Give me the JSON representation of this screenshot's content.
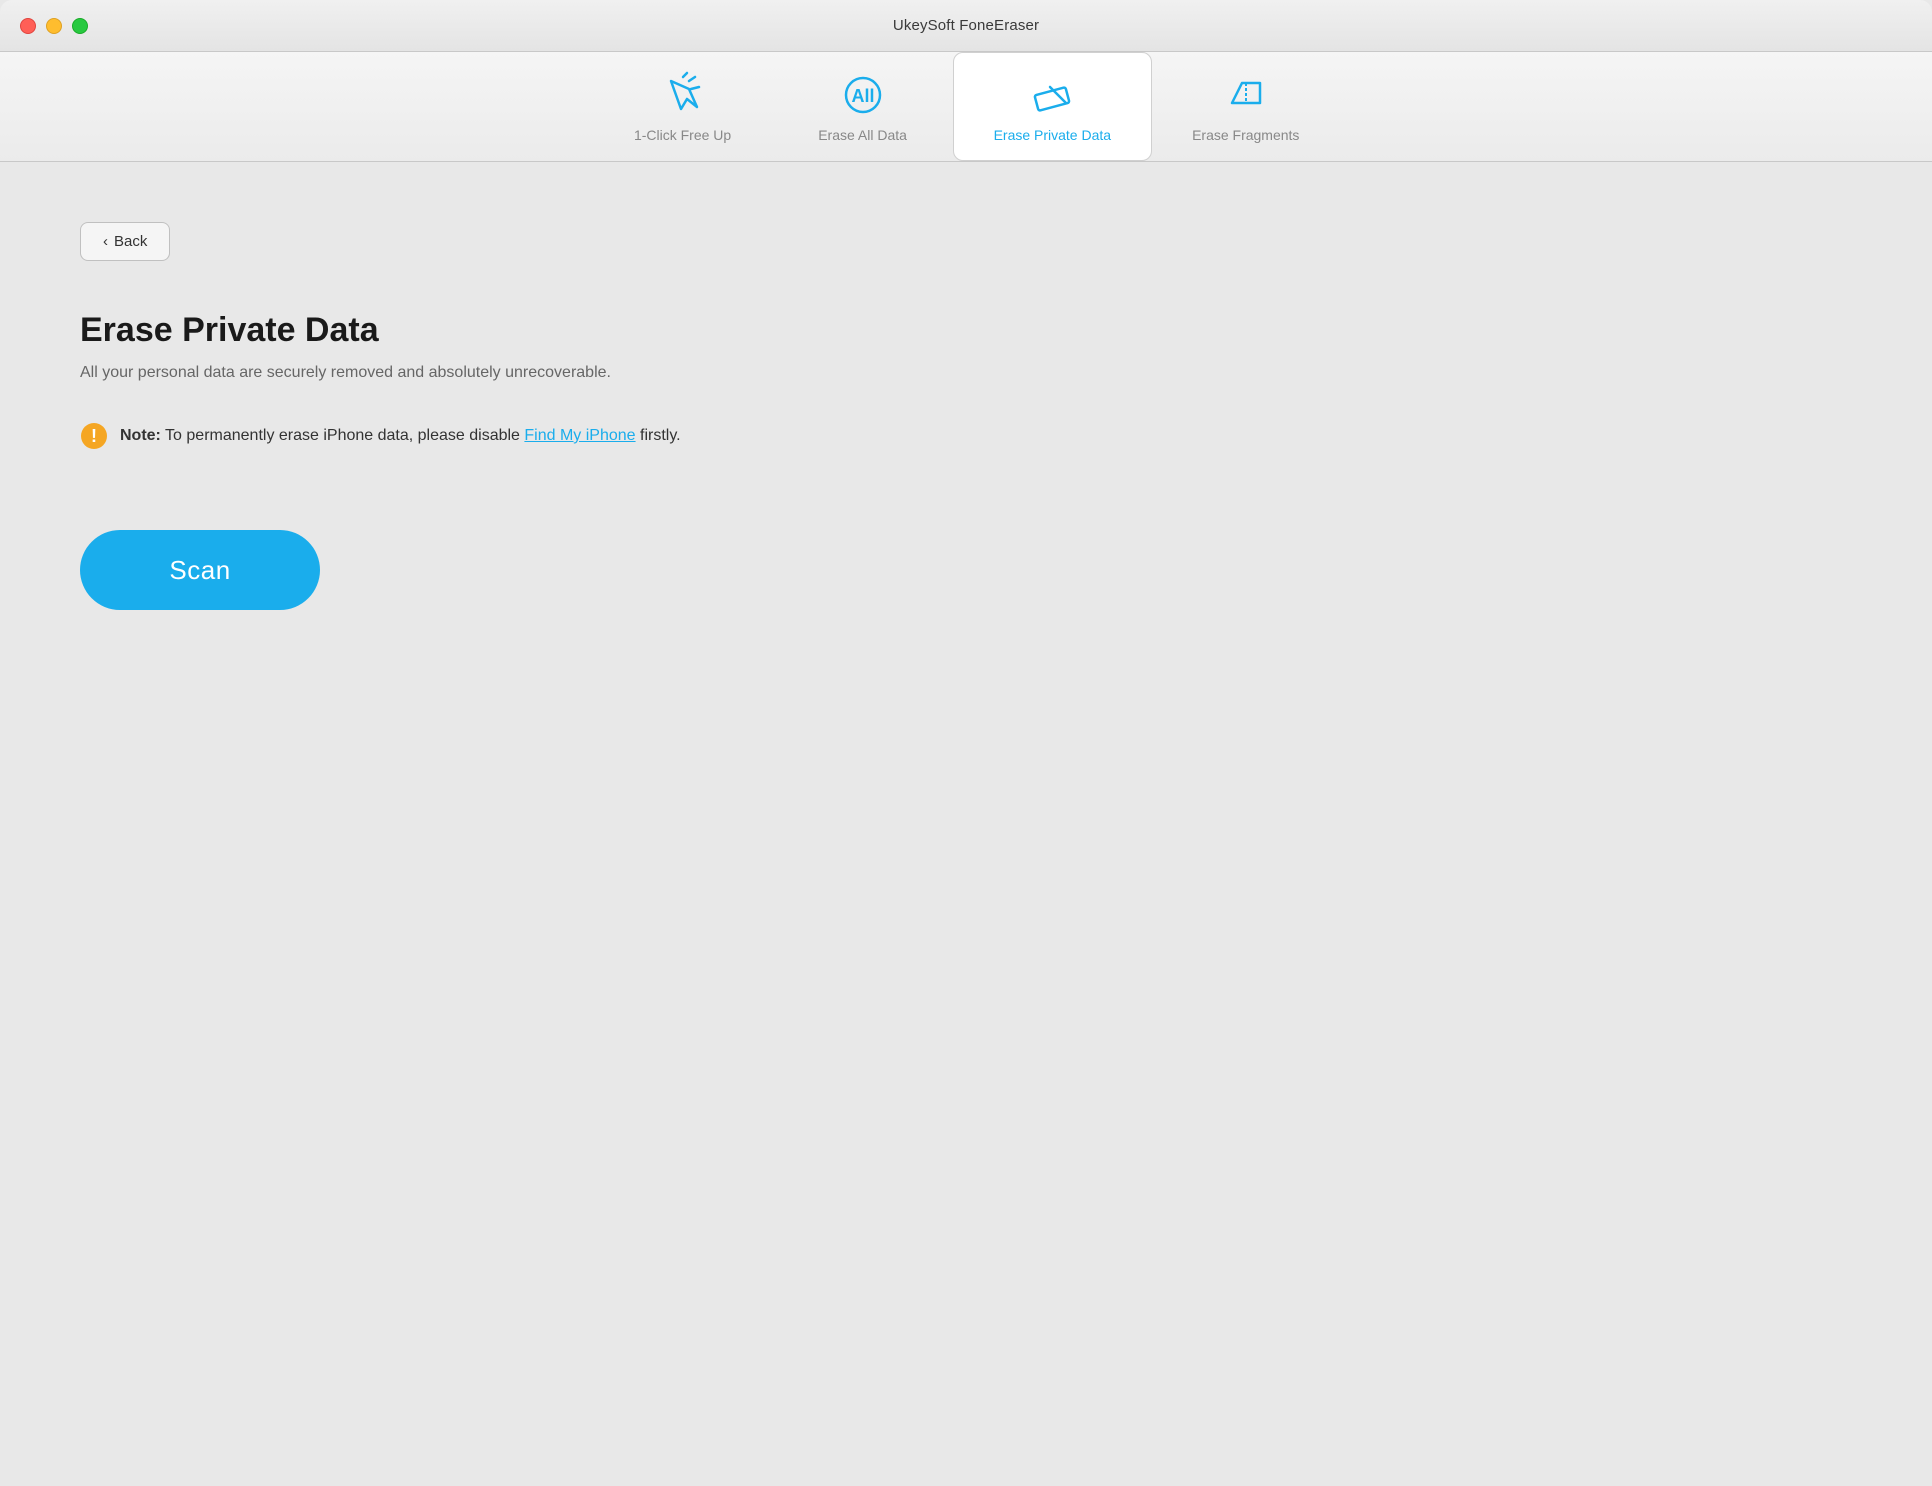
{
  "window": {
    "title": "UkeySoft FoneEraser"
  },
  "traffic_lights": {
    "close_label": "close",
    "minimize_label": "minimize",
    "maximize_label": "maximize"
  },
  "nav": {
    "tabs": [
      {
        "id": "one-click",
        "label": "1-Click Free Up",
        "active": false
      },
      {
        "id": "erase-all",
        "label": "Erase All Data",
        "active": false
      },
      {
        "id": "erase-private",
        "label": "Erase Private Data",
        "active": true
      },
      {
        "id": "erase-fragments",
        "label": "Erase Fragments",
        "active": false
      }
    ]
  },
  "content": {
    "back_label": "Back",
    "back_chevron": "‹",
    "page_title": "Erase Private Data",
    "page_subtitle": "All your personal data are securely removed and absolutely unrecoverable.",
    "note_prefix": "Note:",
    "note_text": " To permanently erase iPhone data, please disable ",
    "note_link": "Find My iPhone",
    "note_suffix": " firstly.",
    "scan_button_label": "Scan"
  }
}
